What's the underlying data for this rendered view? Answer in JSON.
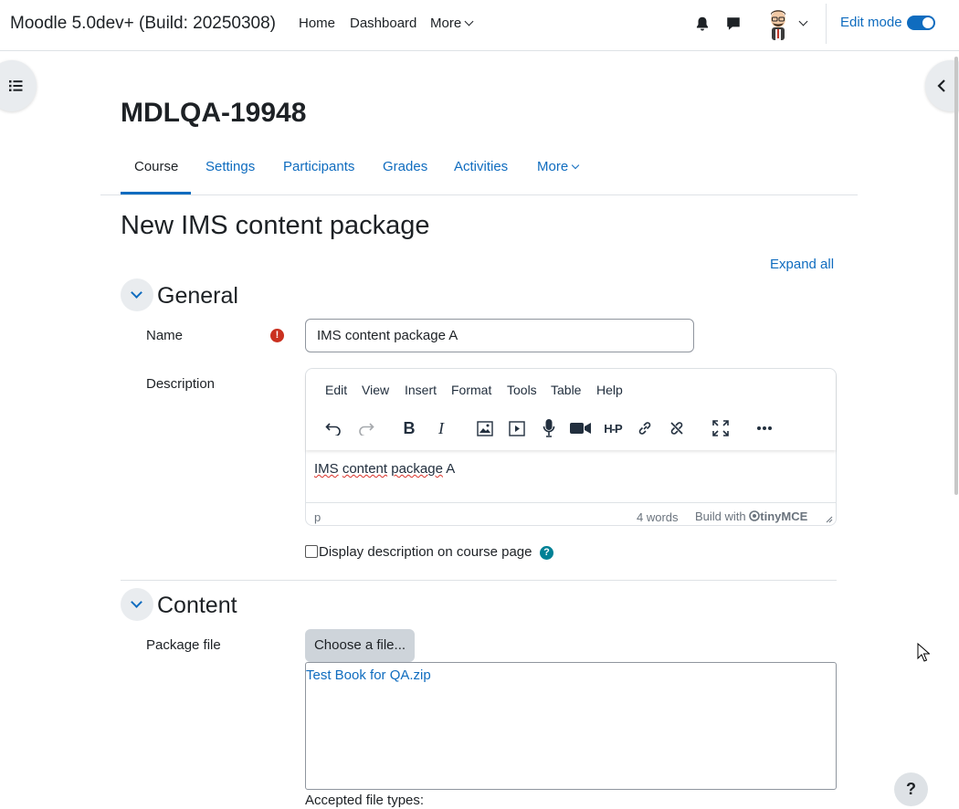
{
  "navbar": {
    "site_title": "Moodle 5.0dev+ (Build: 20250308)",
    "links": [
      "Home",
      "Dashboard",
      "More"
    ],
    "icons": [
      "bell-icon",
      "chat-icon"
    ],
    "edit_mode_label": "Edit mode",
    "edit_mode_on": true
  },
  "course": {
    "title": "MDLQA-19948",
    "tabs": [
      "Course",
      "Settings",
      "Participants",
      "Grades",
      "Activities",
      "More"
    ],
    "active_tab": "Course"
  },
  "page": {
    "heading": "New IMS content package",
    "expand_all": "Expand all"
  },
  "general": {
    "title": "General",
    "name_label": "Name",
    "name_value": "IMS content package A",
    "description_label": "Description",
    "editor": {
      "menu": [
        "Edit",
        "View",
        "Insert",
        "Format",
        "Tools",
        "Table",
        "Help"
      ],
      "toolbar_icons": [
        "undo-icon",
        "redo-icon",
        "bold-icon",
        "italic-icon",
        "image-icon",
        "media-icon",
        "microphone-icon",
        "video-camera-icon",
        "h5p-icon",
        "link-icon",
        "unlink-icon",
        "fullscreen-icon",
        "more-icon"
      ],
      "content_word1": "IMS",
      "content_word2": "content",
      "content_word3": "package",
      "content_word4": "A",
      "status_path": "p",
      "word_count": "4 words",
      "build_with": "Build with",
      "brand": "tinyMCE"
    },
    "display_description_label": "Display description on course page"
  },
  "content": {
    "title": "Content",
    "package_file_label": "Package file",
    "choose_file": "Choose a file...",
    "file_name": "Test Book for QA.zip",
    "accepted_types": "Accepted file types:"
  },
  "colors": {
    "primary": "#0f6cbf",
    "danger": "#ca3120",
    "info": "#008196"
  }
}
